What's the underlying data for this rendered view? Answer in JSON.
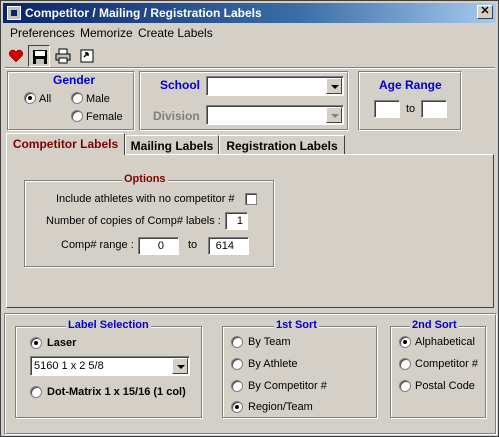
{
  "window": {
    "title": "Competitor / Mailing / Registration Labels",
    "close_label": "✕"
  },
  "menu": [
    "Preferences",
    "Memorize",
    "Create Labels"
  ],
  "toolbar": [
    "heart-icon",
    "save-icon",
    "print-icon",
    "exit-icon"
  ],
  "filters": {
    "gender": {
      "title": "Gender",
      "options": [
        "All",
        "Male",
        "Female"
      ],
      "selected": "All"
    },
    "school": {
      "label": "School",
      "value": ""
    },
    "division": {
      "label": "Division",
      "value": "",
      "enabled": false
    },
    "age_range": {
      "title": "Age Range",
      "from": "",
      "to_label": "to",
      "to": ""
    }
  },
  "tabs": [
    "Competitor Labels",
    "Mailing Labels",
    "Registration Labels"
  ],
  "active_tab": "Competitor Labels",
  "options": {
    "title": "Options",
    "include_no_comp_label": "Include athletes with no competitor #",
    "include_no_comp_checked": false,
    "copies_label": "Number of copies of Comp# labels :",
    "copies_value": "1",
    "range_label": "Comp# range :",
    "range_from": "0",
    "range_to_label": "to",
    "range_to": "614"
  },
  "label_selection": {
    "title": "Label Selection",
    "laser_label": "Laser",
    "laser_selected": true,
    "laser_size": "5160  1 x 2 5/8",
    "dot_label": "Dot-Matrix 1 x 15/16 (1 col)",
    "dot_selected": false
  },
  "sort1": {
    "title": "1st Sort",
    "options": [
      "By Team",
      "By Athlete",
      "By Competitor #",
      "Region/Team"
    ],
    "selected": "Region/Team"
  },
  "sort2": {
    "title": "2nd Sort",
    "options": [
      "Alphabetical",
      "Competitor #",
      "Postal Code"
    ],
    "selected": "Alphabetical"
  },
  "colors": {
    "accent_blue": "#0000cc",
    "active_tab_text": "#800000",
    "title_bar": "#0a246a"
  }
}
